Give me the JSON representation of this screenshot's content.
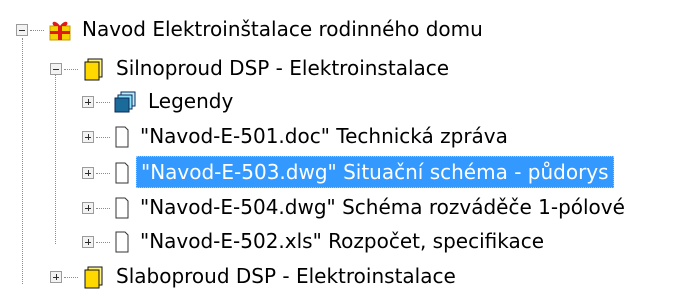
{
  "tree": {
    "root": {
      "label": "Navod Elektroinštalace rodinného domu",
      "expanded": true
    },
    "silnoproud": {
      "label": "Silnoproud   DSP  - Elektroinstalace",
      "expanded": true
    },
    "legendy": {
      "label": "Legendy",
      "expanded": false
    },
    "files": [
      {
        "label": "\"Navod-E-501.doc\"   Technická zpráva",
        "selected": false
      },
      {
        "label": "\"Navod-E-503.dwg\"   Situační schéma - půdorys",
        "selected": true
      },
      {
        "label": "\"Navod-E-504.dwg\"   Schéma rozváděče 1-pólové",
        "selected": false
      },
      {
        "label": "\"Navod-E-502.xls\"   Rozpočet, specifikace",
        "selected": false
      }
    ],
    "slaboproud": {
      "label": "Slaboproud  DSP  - Elektroinstalace",
      "expanded": false
    }
  },
  "colors": {
    "selection_background": "#3399ff",
    "selection_text": "#ffffff",
    "folder_yellow": "#ffd800",
    "gift_red": "#e01a1a"
  }
}
